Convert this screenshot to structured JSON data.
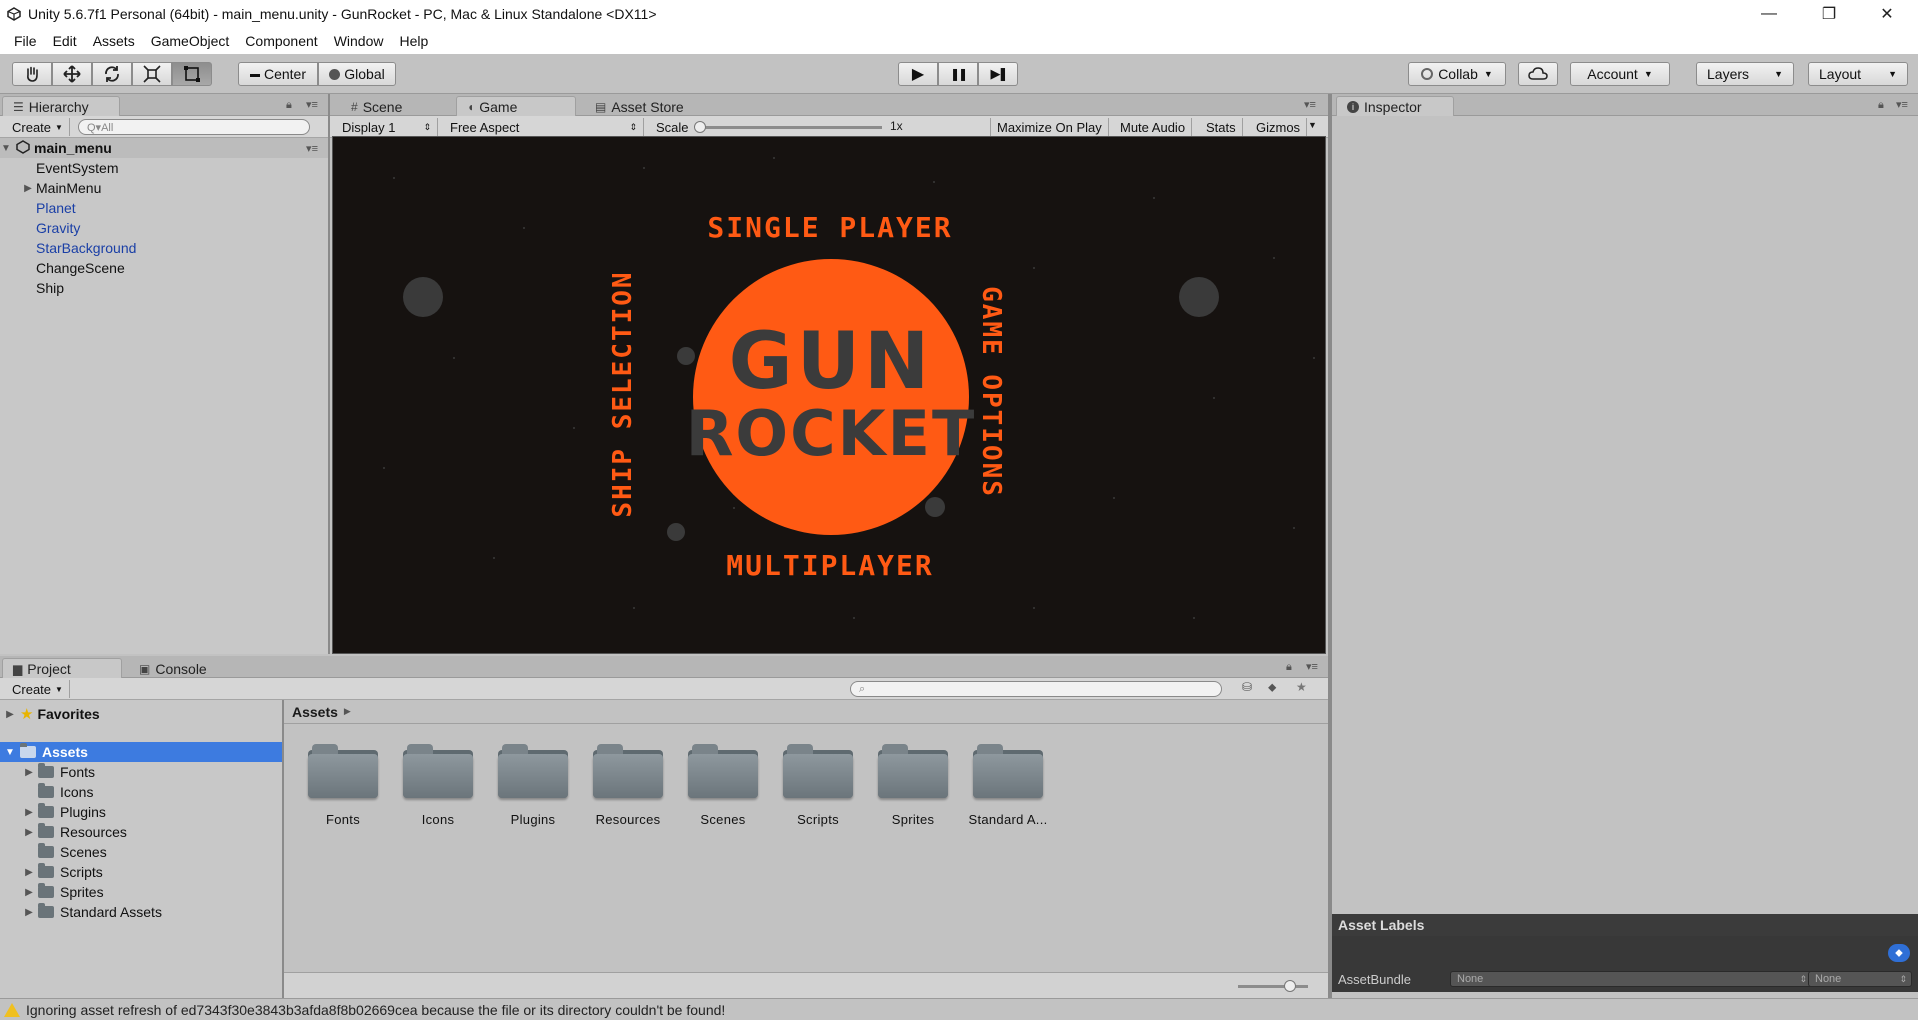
{
  "window": {
    "title": "Unity 5.6.7f1 Personal (64bit) - main_menu.unity - GunRocket - PC, Mac & Linux Standalone <DX11>",
    "minimize": "—",
    "maximize": "❐",
    "close": "✕"
  },
  "menubar": [
    "File",
    "Edit",
    "Assets",
    "GameObject",
    "Component",
    "Window",
    "Help"
  ],
  "toolbar": {
    "tools": [
      "hand-tool",
      "move-tool",
      "rotate-tool",
      "scale-tool",
      "rect-tool"
    ],
    "pivot_label": "Center",
    "space_label": "Global",
    "play": "▶",
    "pause": "❚❚",
    "step": "▶❚",
    "collab_label": "Collab",
    "account_label": "Account",
    "layers_label": "Layers",
    "layout_label": "Layout"
  },
  "hierarchy": {
    "tab_label": "Hierarchy",
    "create_label": "Create",
    "search_placeholder": "Q▾All",
    "scene_name": "main_menu",
    "items": [
      {
        "label": "EventSystem",
        "color": "normal",
        "expandable": false
      },
      {
        "label": "MainMenu",
        "color": "normal",
        "expandable": true
      },
      {
        "label": "Planet",
        "color": "prefab",
        "expandable": false
      },
      {
        "label": "Gravity",
        "color": "prefab",
        "expandable": false
      },
      {
        "label": "StarBackground",
        "color": "prefab",
        "expandable": false
      },
      {
        "label": "ChangeScene",
        "color": "normal",
        "expandable": false
      },
      {
        "label": "Ship",
        "color": "normal",
        "expandable": false
      }
    ]
  },
  "center_tabs": {
    "scene_label": "Scene",
    "game_label": "Game",
    "store_label": "Asset Store"
  },
  "game_toolbar": {
    "display": "Display 1",
    "aspect": "Free Aspect",
    "scale_label": "Scale",
    "scale_value": "1x",
    "maximize": "Maximize On Play",
    "mute": "Mute Audio",
    "stats": "Stats",
    "gizmos": "Gizmos"
  },
  "game": {
    "single_player": "SINGLE PLAYER",
    "multiplayer": "MULTIPLAYER",
    "ship_selection": "SHIP SELECTION",
    "game_options": "GAME OPTIONS",
    "logo_line1": "GUN",
    "logo_line2": "ROCKET",
    "accent": "#ff5a14"
  },
  "inspector": {
    "tab_label": "Inspector",
    "asset_labels": "Asset Labels",
    "asset_bundle_label": "AssetBundle",
    "bundle_value": "None",
    "variant_value": "None"
  },
  "project": {
    "project_tab": "Project",
    "console_tab": "Console",
    "create_label": "Create",
    "favorites_label": "Favorites",
    "assets_label": "Assets",
    "breadcrumb": "Assets",
    "tree": [
      {
        "label": "Fonts",
        "expandable": true
      },
      {
        "label": "Icons",
        "expandable": false
      },
      {
        "label": "Plugins",
        "expandable": true
      },
      {
        "label": "Resources",
        "expandable": true
      },
      {
        "label": "Scenes",
        "expandable": false
      },
      {
        "label": "Scripts",
        "expandable": true
      },
      {
        "label": "Sprites",
        "expandable": true
      },
      {
        "label": "Standard Assets",
        "expandable": true
      }
    ],
    "folders": [
      "Fonts",
      "Icons",
      "Plugins",
      "Resources",
      "Scenes",
      "Scripts",
      "Sprites",
      "Standard A..."
    ]
  },
  "status": {
    "message": "Ignoring asset refresh of ed7343f30e3843b3afda8f8b02669cea because the file or its directory couldn't be found!"
  }
}
